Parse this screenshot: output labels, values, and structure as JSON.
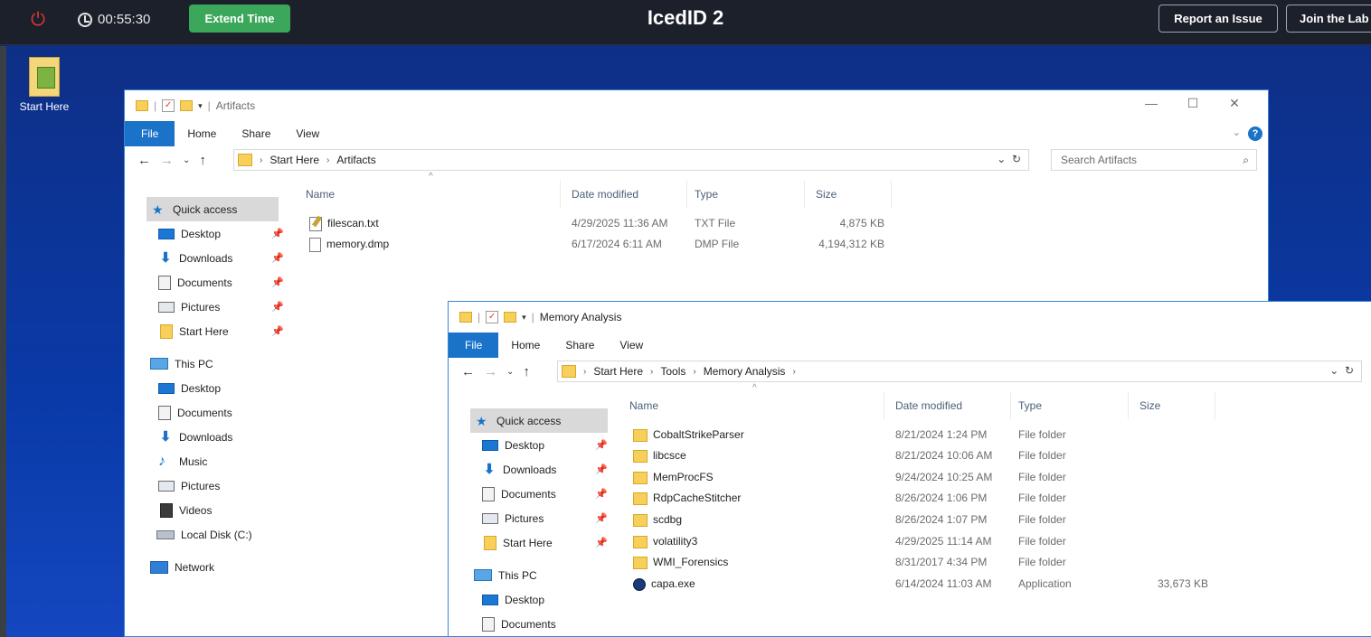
{
  "topbar": {
    "timer": "00:55:30",
    "extend_label": "Extend Time",
    "title": "IcedID 2",
    "report_label": "Report an Issue",
    "join_label": "Join the Lab"
  },
  "desktop": {
    "icon_label": "Start Here"
  },
  "window1": {
    "title": "Artifacts",
    "ribbon_tabs": [
      "File",
      "Home",
      "Share",
      "View"
    ],
    "path": [
      "Start Here",
      "Artifacts"
    ],
    "search_placeholder": "Search Artifacts",
    "nav": {
      "quick_access": "Quick access",
      "qa_items": [
        "Desktop",
        "Downloads",
        "Documents",
        "Pictures",
        "Start Here"
      ],
      "this_pc": "This PC",
      "pc_items": [
        "Desktop",
        "Documents",
        "Downloads",
        "Music",
        "Pictures",
        "Videos",
        "Local Disk (C:)"
      ],
      "network": "Network"
    },
    "columns": [
      "Name",
      "Date modified",
      "Type",
      "Size"
    ],
    "files": [
      {
        "name": "filescan.txt",
        "date": "4/29/2025 11:36 AM",
        "type": "TXT File",
        "size": "4,875 KB"
      },
      {
        "name": "memory.dmp",
        "date": "6/17/2024 6:11 AM",
        "type": "DMP File",
        "size": "4,194,312 KB"
      }
    ]
  },
  "window2": {
    "title": "Memory Analysis",
    "ribbon_tabs": [
      "File",
      "Home",
      "Share",
      "View"
    ],
    "path": [
      "Start Here",
      "Tools",
      "Memory Analysis"
    ],
    "nav": {
      "quick_access": "Quick access",
      "qa_items": [
        "Desktop",
        "Downloads",
        "Documents",
        "Pictures",
        "Start Here"
      ],
      "this_pc": "This PC",
      "pc_items": [
        "Desktop",
        "Documents"
      ]
    },
    "columns": [
      "Name",
      "Date modified",
      "Type",
      "Size"
    ],
    "files": [
      {
        "name": "CobaltStrikeParser",
        "date": "8/21/2024 1:24 PM",
        "type": "File folder",
        "size": ""
      },
      {
        "name": "libcsce",
        "date": "8/21/2024 10:06 AM",
        "type": "File folder",
        "size": ""
      },
      {
        "name": "MemProcFS",
        "date": "9/24/2024 10:25 AM",
        "type": "File folder",
        "size": ""
      },
      {
        "name": "RdpCacheStitcher",
        "date": "8/26/2024 1:06 PM",
        "type": "File folder",
        "size": ""
      },
      {
        "name": "scdbg",
        "date": "8/26/2024 1:07 PM",
        "type": "File folder",
        "size": ""
      },
      {
        "name": "volatility3",
        "date": "4/29/2025 11:14 AM",
        "type": "File folder",
        "size": ""
      },
      {
        "name": "WMI_Forensics",
        "date": "8/31/2017 4:34 PM",
        "type": "File folder",
        "size": ""
      },
      {
        "name": "capa.exe",
        "date": "6/14/2024 11:03 AM",
        "type": "Application",
        "size": "33,673 KB"
      }
    ]
  }
}
